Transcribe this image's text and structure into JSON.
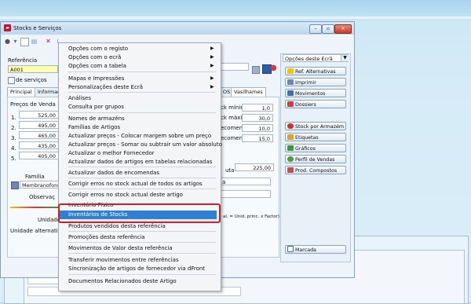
{
  "window": {
    "title": "Stocks e Serviços",
    "controls": [
      "min",
      "max",
      "close"
    ]
  },
  "form": {
    "referencia_label": "Referência",
    "referencia_value": "A001",
    "servicos_label": "de serviços",
    "tabs": [
      "Principal",
      "Informaçõ",
      "OS",
      "Vasilhames"
    ],
    "precos_label": "Preços de Venda",
    "precos": [
      {
        "n": "1.",
        "v": "525,00"
      },
      {
        "n": "2.",
        "v": "495,00"
      },
      {
        "n": "3.",
        "v": "465,00"
      },
      {
        "n": "4.",
        "v": "435,00"
      },
      {
        "n": "5.",
        "v": "405,00"
      }
    ],
    "familia_label": "Familia",
    "familia_value": "Membranofones",
    "observ_label": "Observaç",
    "unidade_label": "Unidade",
    "unidade_alt_label": "Unidade alternativa",
    "stock_rows": [
      {
        "label": "ck mínimo",
        "value": "1,0"
      },
      {
        "label": "ck máximo",
        "value": "30,0"
      },
      {
        "label": "ecomenda",
        "value": "10,0"
      },
      {
        "label": "ecomenda",
        "value": "15,0"
      }
    ],
    "bruta_label": "uta",
    "bruta_value": "225,00",
    "a_label": "a",
    "factor_text": "al. = Unid. princ. x Factor)"
  },
  "side": {
    "select_value": "Opções deste Ecrã",
    "buttons": [
      {
        "label": "Ref. Alternativas",
        "color": "#f2c400"
      },
      {
        "label": "Imprimir",
        "color": "#6d86b5"
      },
      {
        "label": "Movimentos",
        "color": "#3b6fb6"
      },
      {
        "label": "Dossiers",
        "color": "#c84040"
      },
      {
        "label": "Stock por Armazém",
        "color": "#d03030"
      },
      {
        "label": "Etiquetas",
        "color": "#d7a52a"
      },
      {
        "label": "Gráficos",
        "color": "#3a9a3a"
      },
      {
        "label": "Perfil de Vendas",
        "color": "#4f9c3a"
      },
      {
        "label": "Prod. Compostos",
        "color": "#c05050"
      }
    ],
    "marcada_label": "Marcada"
  },
  "menu": {
    "items": [
      {
        "label": "Opções com o registo",
        "submenu": true
      },
      {
        "label": "Opções com o ecrã",
        "submenu": true
      },
      {
        "label": "Opções com a tabela",
        "submenu": true
      },
      {
        "label": "Mapas e Impressões",
        "submenu": true
      },
      {
        "label": "Personalizações deste Ecrã",
        "submenu": true
      },
      {
        "label": "Análises",
        "submenu": false
      },
      {
        "label": "Consulta por grupos",
        "submenu": false
      },
      {
        "label": "Nomes de armazéns",
        "submenu": false
      },
      {
        "label": "Famílias de Artigos",
        "submenu": false
      },
      {
        "label": "Actualizar preços - Colocar margem sobre um preço",
        "submenu": false
      },
      {
        "label": "Actualizar preços - Somar ou subtrair um valor absoluto",
        "submenu": false
      },
      {
        "label": "Actualizar o melhor Fornecedor",
        "submenu": false
      },
      {
        "label": "Actualizar dados de artigos em tabelas relacionadas",
        "submenu": false
      },
      {
        "label": "Actualizar dados de encomendas",
        "submenu": false
      },
      {
        "label": "Corrigir erros no stock actual de todos os artigos",
        "submenu": false
      },
      {
        "label": "Corrigir erros no stock actual deste artigo",
        "submenu": false
      },
      {
        "label": "Inventário Físico",
        "submenu": false
      },
      {
        "label": "Inventários de Stocks",
        "submenu": false
      },
      {
        "label": "Produtos vendidos desta referência",
        "submenu": false
      },
      {
        "label": "Promoções desta referência",
        "submenu": false
      },
      {
        "label": "Movimentos de Valor desta referência",
        "submenu": false
      },
      {
        "label": "Transferir movimentos entre referências",
        "submenu": false
      },
      {
        "label": "Sincronização de artigos de fornecedor via dFront",
        "submenu": false
      },
      {
        "label": "Documentos Relacionados deste Artigo",
        "submenu": false
      }
    ],
    "selected_index": 17,
    "arrow_glyph": "▶"
  }
}
